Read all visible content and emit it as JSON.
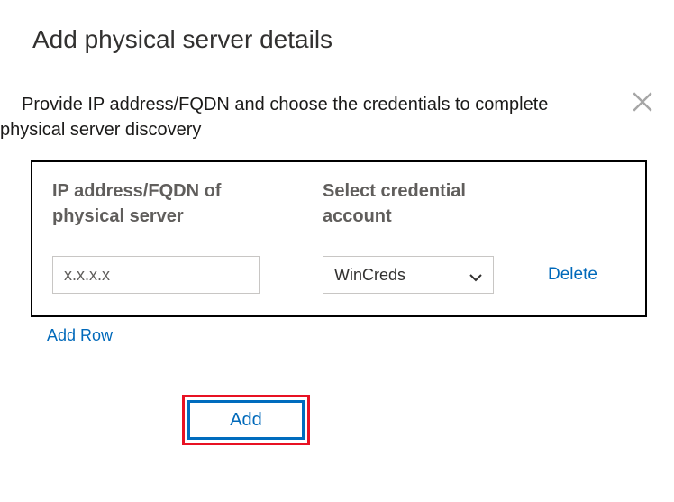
{
  "title": "Add physical server details",
  "description_line1": "Provide IP address/FQDN and choose the credentials to complete",
  "description_line2": "physical server discovery",
  "headers": {
    "ip": "IP address/FQDN of physical server",
    "cred": "Select credential account"
  },
  "row": {
    "ip_value": "x.x.x.x",
    "cred_value": "WinCreds",
    "delete_label": "Delete"
  },
  "links": {
    "add_row": "Add Row"
  },
  "buttons": {
    "add": "Add"
  }
}
